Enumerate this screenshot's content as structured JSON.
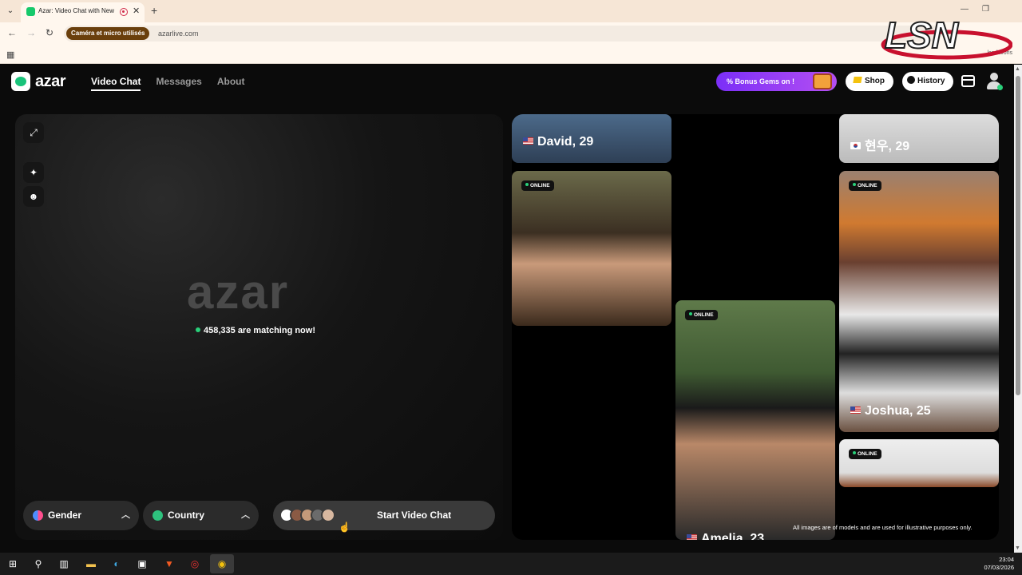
{
  "browser": {
    "tab_title": "Azar: Video Chat with New",
    "tab_close": "✕",
    "new_tab": "+",
    "camera_notice": "Caméra et micro utilisés",
    "url": "azarlive.com",
    "favorites_label": "les favoris"
  },
  "header": {
    "brand": "azar",
    "nav": [
      "Video Chat",
      "Messages",
      "About"
    ],
    "bonus_text": "% Bonus Gems on !",
    "shop_label": "Shop",
    "history_label": "History"
  },
  "video_panel": {
    "watermark": "azar",
    "matching_text": "458,335 are matching now!",
    "gender_label": "Gender",
    "country_label": "Country",
    "start_label": "Start Video Chat"
  },
  "gallery": {
    "online_label": "ONLINE",
    "profiles": [
      {
        "name": "David, 29",
        "flag": "us"
      },
      {
        "name": "현우, 29",
        "flag": "kr"
      },
      {
        "name": "Joshua, 25",
        "flag": "us"
      },
      {
        "name": "Amelia, 23",
        "flag": "us"
      }
    ],
    "disclaimer": "All images are of models and are used for illustrative purposes only."
  },
  "taskbar": {
    "time": "23:04",
    "date": "07/03/2026"
  },
  "colors": {
    "accent_green": "#29d07a",
    "bonus_purple": "#7b2ff7",
    "page_bg": "#0b0b0b"
  }
}
